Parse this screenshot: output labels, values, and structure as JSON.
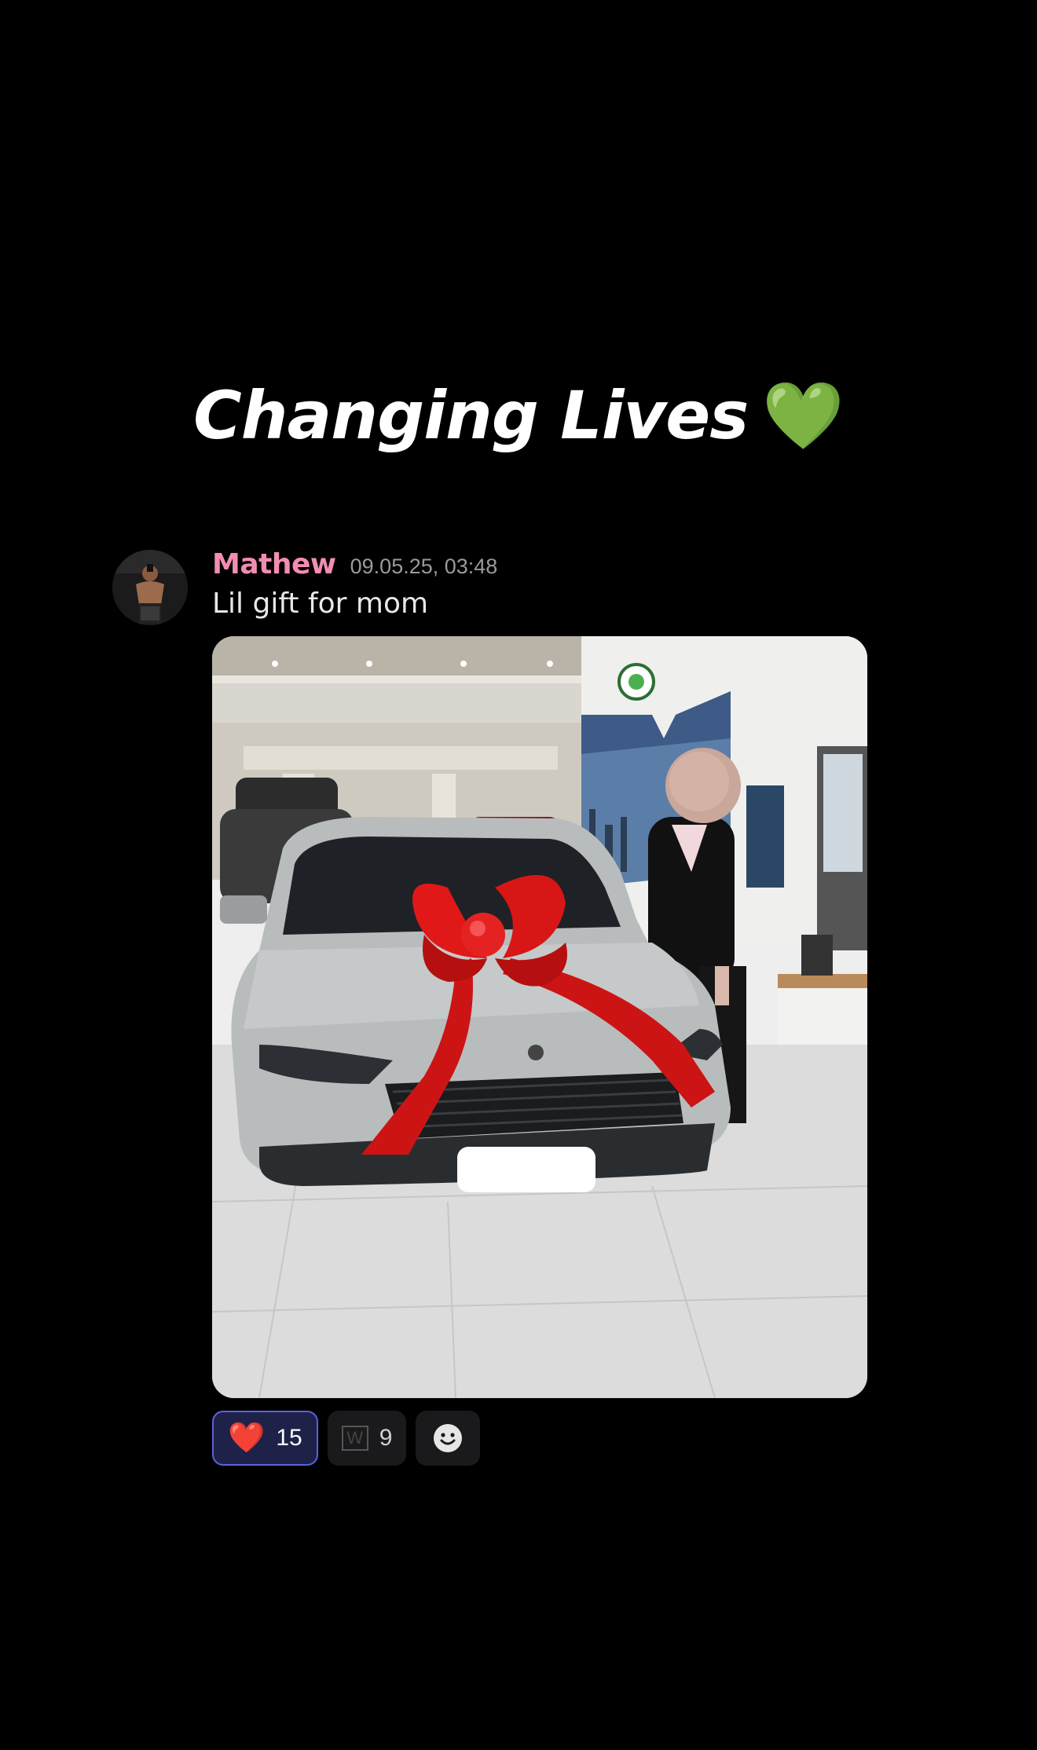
{
  "headline": {
    "text": "Changing Lives",
    "emoji": "💚"
  },
  "message": {
    "username": "Mathew",
    "timestamp": "09.05.25, 03:48",
    "text": "Lil gift for mom"
  },
  "reactions": [
    {
      "emoji": "❤️",
      "icon": "red-heart-icon",
      "count": "15",
      "selected": true
    },
    {
      "emoji": "W",
      "icon": "w-box-icon",
      "count": "9",
      "selected": false
    }
  ],
  "add_reaction_icon": "smiley-icon",
  "colors": {
    "background": "#000000",
    "username": "#f28cb4",
    "timestamp": "#9a9a9a",
    "selected_reaction_border": "#5a62e0",
    "selected_reaction_bg": "#1e2148",
    "reaction_bg": "#1a1a1c"
  }
}
